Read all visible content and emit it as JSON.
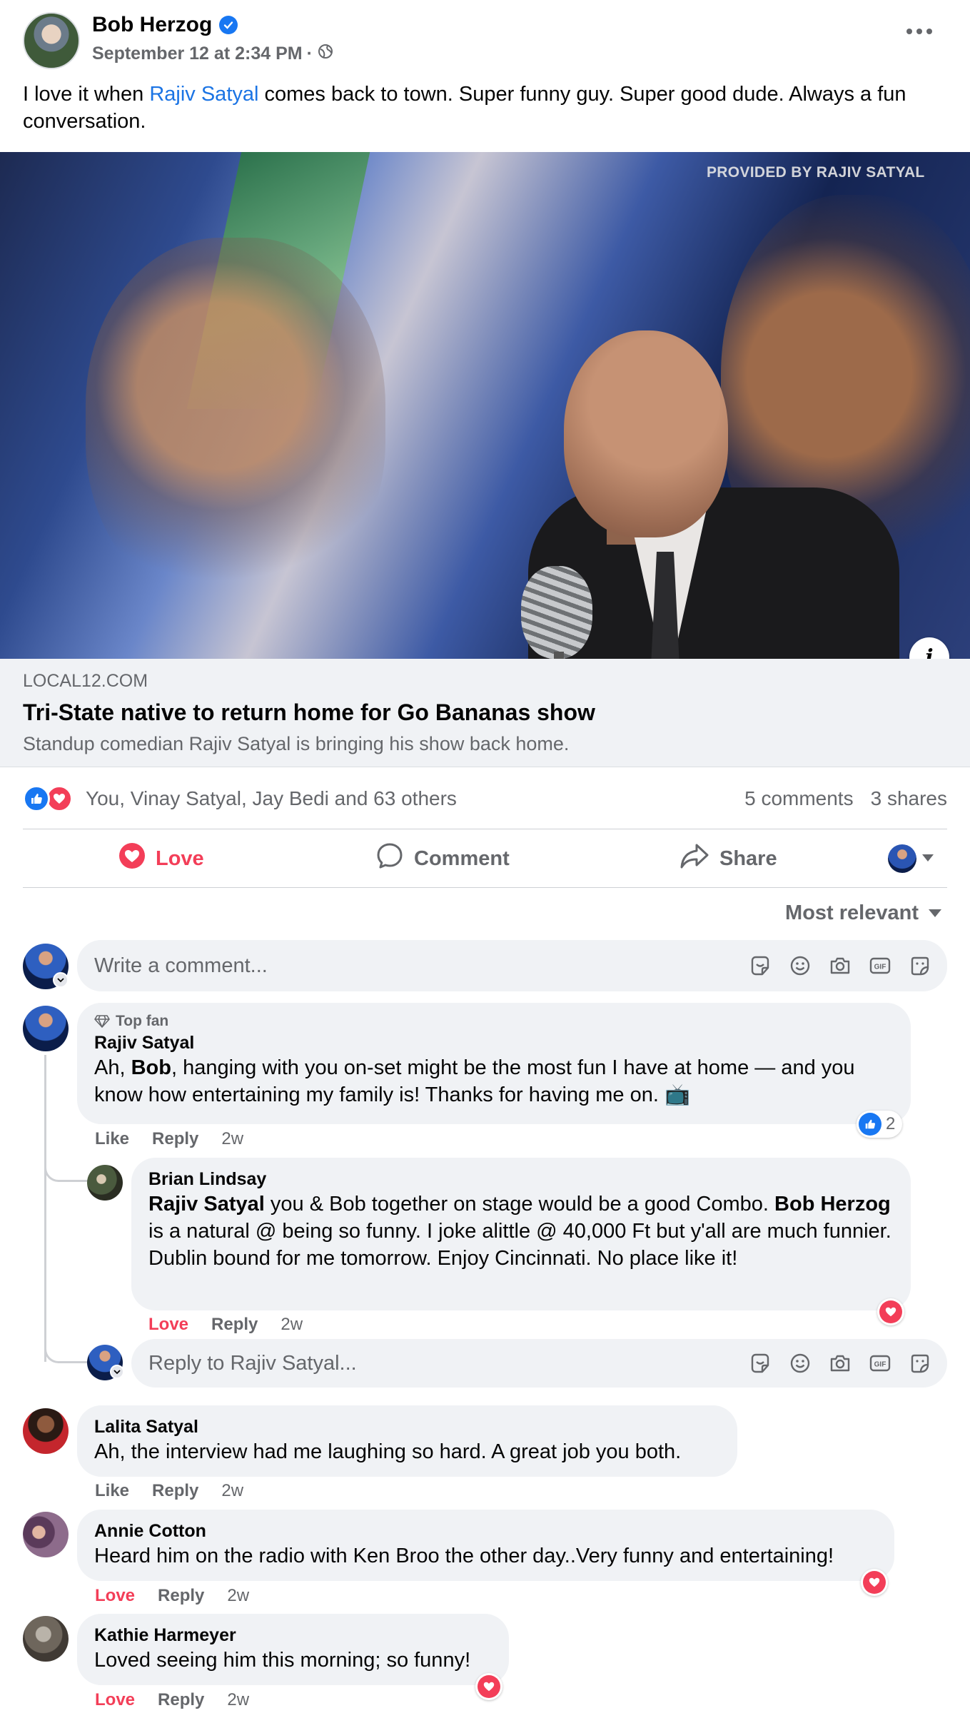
{
  "post": {
    "author": "Bob Herzog",
    "timestamp": "September 12 at 2:34 PM",
    "separator": "·",
    "text_before": "I love it when ",
    "mention": "Rajiv Satyal",
    "text_after": " comes back to town.  Super funny guy. Super good dude. Always a fun conversation."
  },
  "link_preview": {
    "watermark": "PROVIDED BY RAJIV SATYAL",
    "domain": "LOCAL12.COM",
    "title": "Tri-State native to return home for Go Bananas show",
    "description": "Standup comedian Rajiv Satyal is bringing his show back home."
  },
  "reactions": {
    "names": "You, Vinay Satyal, Jay Bedi and 63 others",
    "comments": "5 comments",
    "shares": "3 shares"
  },
  "actions": {
    "love": "Love",
    "comment": "Comment",
    "share": "Share"
  },
  "sort_label": "Most relevant",
  "composer": {
    "placeholder": "Write a comment...",
    "reply_placeholder": "Reply to Rajiv Satyal..."
  },
  "comments": [
    {
      "badge": "Top fan",
      "name": "Rajiv Satyal",
      "text_1": "Ah, ",
      "bold_1": "Bob",
      "text_2": ", hanging with you on-set might be the most fun I have at home — and you know how entertaining my family is! Thanks for having me on. 📺",
      "action_react": "Like",
      "action_reply": "Reply",
      "time": "2w",
      "reaction_count": "2"
    },
    {
      "name": "Brian Lindsay",
      "bold_1": "Rajiv Satyal",
      "text_1": " you & Bob together on stage would be a good Combo. ",
      "bold_2": "Bob Herzog",
      "text_2": " is a natural @ being so funny. I joke alittle @ 40,000 Ft but y'all are much funnier. Dublin bound for me tomorrow. Enjoy Cincinnati. No place like it!",
      "action_react": "Love",
      "action_reply": "Reply",
      "time": "2w"
    },
    {
      "name": "Lalita Satyal",
      "text": "Ah, the interview had me laughing so hard. A great job you both.",
      "action_react": "Like",
      "action_reply": "Reply",
      "time": "2w"
    },
    {
      "name": "Annie Cotton",
      "text": "Heard him on the radio with Ken Broo the other day..Very funny and entertaining!",
      "action_react": "Love",
      "action_reply": "Reply",
      "time": "2w"
    },
    {
      "name": "Kathie Harmeyer",
      "text": "Loved seeing him this morning; so funny!",
      "action_react": "Love",
      "action_reply": "Reply",
      "time": "2w"
    }
  ],
  "colors": {
    "accent_blue": "#1877f2",
    "mention_blue": "#1b74e4",
    "love_red": "#f33e58",
    "secondary_text": "#65676b",
    "bubble_bg": "#f0f2f5"
  },
  "icons": [
    "verified-badge-icon",
    "globe-icon",
    "more-options-icon",
    "info-icon",
    "like-reaction-icon",
    "love-reaction-icon",
    "heart-icon",
    "comment-icon",
    "share-icon",
    "avatar-icon",
    "diamond-icon",
    "sticker-icon",
    "emoji-icon",
    "camera-icon",
    "gif-icon",
    "caret-down-icon"
  ]
}
